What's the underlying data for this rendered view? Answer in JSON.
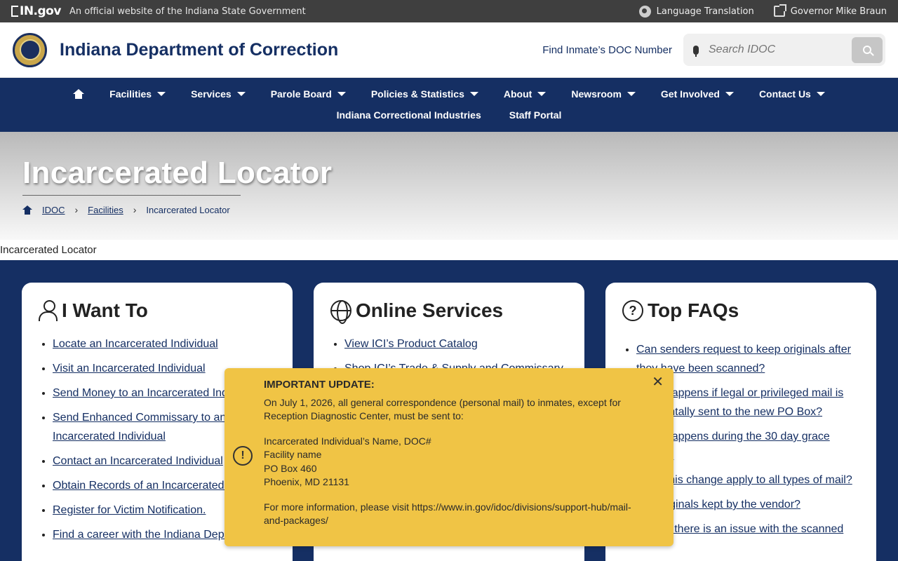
{
  "topbar": {
    "brand": "IN.gov",
    "official": "An official website of the Indiana State Government",
    "links": [
      {
        "label": "Language Translation",
        "icon": "globe-icon"
      },
      {
        "label": "Governor Mike Braun",
        "icon": "external-link-icon"
      }
    ]
  },
  "header": {
    "title": "Indiana Department of Correction",
    "find_inmate": "Find Inmate’s DOC Number",
    "search_placeholder": "Search IDOC"
  },
  "nav": {
    "row1": [
      "Facilities",
      "Services",
      "Parole Board",
      "Policies & Statistics",
      "About",
      "Newsroom",
      "Get Involved",
      "Contact Us"
    ],
    "row2": [
      "Indiana Correctional Industries",
      "Staff Portal"
    ]
  },
  "hero": {
    "title": "Incarcerated Locator",
    "breadcrumb": [
      "IDOC",
      "Facilities",
      "Incarcerated Locator"
    ]
  },
  "page_label": "Incarcerated Locator",
  "cards": [
    {
      "title": "I Want To",
      "icon": "person-icon",
      "items": [
        "Locate an Incarcerated Individual",
        "Visit an Incarcerated Individual",
        "Send Money to an Incarcerated Individual",
        "Send Enhanced Commissary to an Incarcerated Individual",
        "Contact an Incarcerated Individual",
        "Obtain Records of an Incarcerated Individual",
        "Register for Victim Notification.",
        "Find a career with the Indiana Department"
      ]
    },
    {
      "title": "Online Services",
      "icon": "globe-icon",
      "items": [
        "View ICI’s Product Catalog",
        "Shop ICI’s Trade & Supply and Commissary"
      ]
    },
    {
      "title": "Top FAQs",
      "icon": "question-icon",
      "items": [
        "Can senders request to keep originals after they have been scanned?",
        "What happens if legal or privileged mail is accidentally sent to the new PO Box?",
        "What happens during the 30 day grace period?",
        "Does this change apply to all types of mail?",
        "Are originals kept by the vendor?",
        "What if there is an issue with the scanned"
      ]
    }
  ],
  "alert": {
    "title": "IMPORTANT UPDATE:",
    "intro": "On July 1, 2026, all general correspondence (personal mail) to inmates, except for Reception Diagnostic Center, must be sent to:",
    "address": [
      "Incarcerated Individual’s Name, DOC#",
      "Facility name",
      "PO Box 460",
      "Phoenix, MD 21131"
    ],
    "more": "For more information, please visit https://www.in.gov/idoc/divisions/support-hub/mail-and-packages/"
  }
}
